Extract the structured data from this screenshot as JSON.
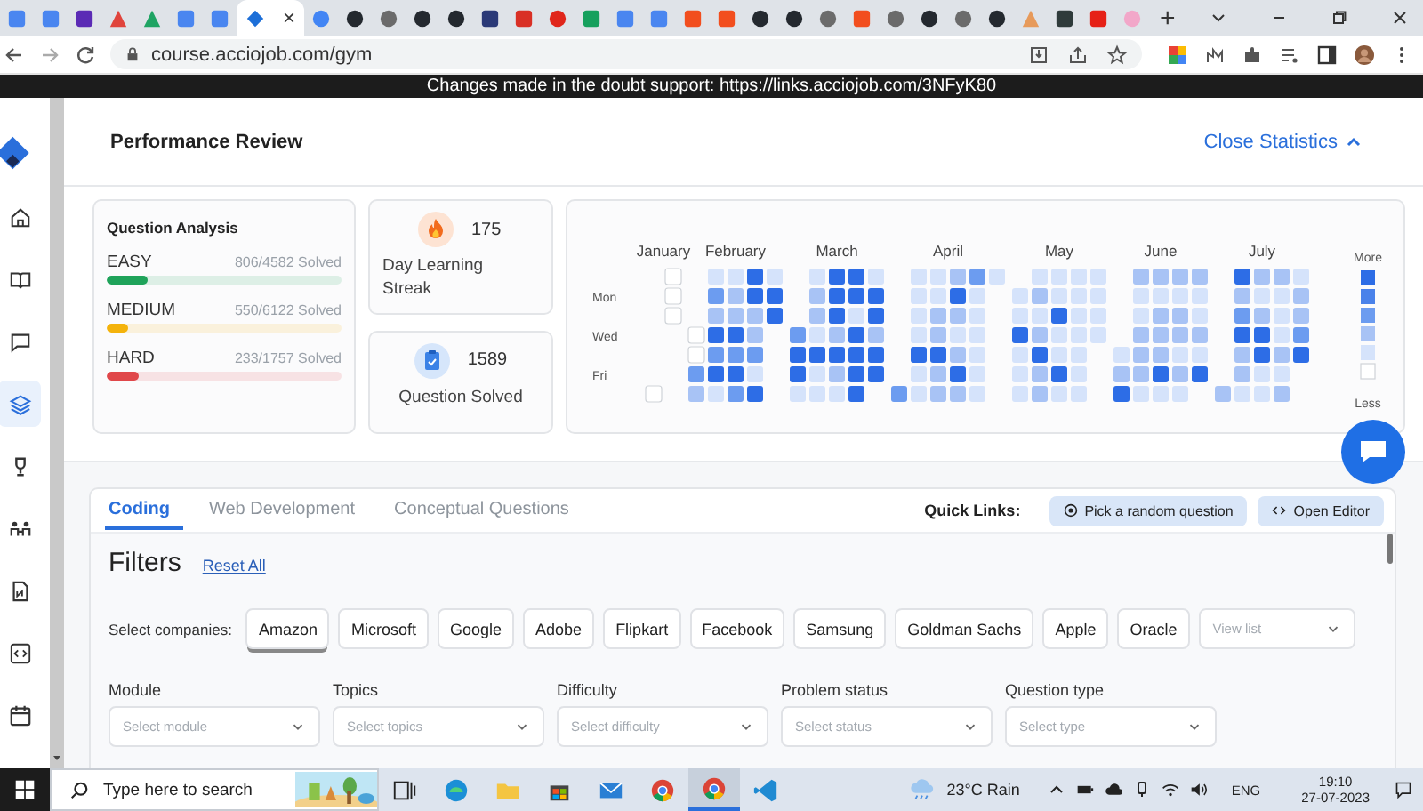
{
  "browser": {
    "tabs": [
      {
        "kind": "square",
        "color": "#4a86f0",
        "selected": false
      },
      {
        "kind": "square",
        "color": "#4a86f0",
        "selected": false
      },
      {
        "kind": "square",
        "color": "#5b2bb5",
        "selected": false
      },
      {
        "kind": "triangle",
        "color": "#e0443c",
        "selected": false
      },
      {
        "kind": "triangle",
        "color": "#1fa463",
        "selected": false
      },
      {
        "kind": "square",
        "color": "#4a86f0",
        "selected": false
      },
      {
        "kind": "square",
        "color": "#4a86f0",
        "selected": false
      },
      {
        "kind": "diamond",
        "color": "#1d6fd8",
        "selected": true
      },
      {
        "kind": "circle",
        "color": "#4285f4",
        "selected": false
      },
      {
        "kind": "circle",
        "color": "#24292f",
        "selected": false
      },
      {
        "kind": "circle",
        "color": "#6b6b6b",
        "selected": false
      },
      {
        "kind": "circle",
        "color": "#24292f",
        "selected": false
      },
      {
        "kind": "circle",
        "color": "#24292f",
        "selected": false
      },
      {
        "kind": "square",
        "color": "#2b3a78",
        "selected": false
      },
      {
        "kind": "square",
        "color": "#d93025",
        "selected": false
      },
      {
        "kind": "circle",
        "color": "#e0261b",
        "selected": false
      },
      {
        "kind": "square",
        "color": "#16a05d",
        "selected": false
      },
      {
        "kind": "square",
        "color": "#4a86f0",
        "selected": false
      },
      {
        "kind": "square",
        "color": "#4a86f0",
        "selected": false
      },
      {
        "kind": "square",
        "color": "#f24e1e",
        "selected": false
      },
      {
        "kind": "square",
        "color": "#f24e1e",
        "selected": false
      },
      {
        "kind": "circle",
        "color": "#24292f",
        "selected": false
      },
      {
        "kind": "circle",
        "color": "#24292f",
        "selected": false
      },
      {
        "kind": "circle",
        "color": "#6b6b6b",
        "selected": false
      },
      {
        "kind": "square",
        "color": "#f24e1e",
        "selected": false
      },
      {
        "kind": "circle",
        "color": "#6b6b6b",
        "selected": false
      },
      {
        "kind": "circle",
        "color": "#24292f",
        "selected": false
      },
      {
        "kind": "circle",
        "color": "#6b6b6b",
        "selected": false
      },
      {
        "kind": "circle",
        "color": "#24292f",
        "selected": false
      },
      {
        "kind": "triangle",
        "color": "#e79a5a",
        "selected": false
      },
      {
        "kind": "square",
        "color": "#2f3b3b",
        "selected": false
      },
      {
        "kind": "square",
        "color": "#e62117",
        "selected": false
      },
      {
        "kind": "circle",
        "color": "#f2a7c9",
        "selected": false
      }
    ],
    "close_glyph": "×",
    "new_tab": "+",
    "url": "course.acciojob.com/gym"
  },
  "banner": "Changes made in the doubt support: https://links.acciojob.com/3NFyK80",
  "sidebar": {
    "items": [
      {
        "kind": "home",
        "selected": false
      },
      {
        "kind": "book",
        "selected": false
      },
      {
        "kind": "chat",
        "selected": false
      },
      {
        "kind": "layers",
        "selected": true
      },
      {
        "kind": "trophy",
        "selected": false
      },
      {
        "kind": "people",
        "selected": false
      },
      {
        "kind": "file",
        "selected": false
      },
      {
        "kind": "code",
        "selected": false
      },
      {
        "kind": "calendar",
        "selected": false
      }
    ]
  },
  "header": {
    "title": "Performance Review",
    "toggle": "Close Statistics"
  },
  "question_analysis": {
    "title": "Question Analysis",
    "rows": [
      {
        "label": "EASY",
        "solved": "806/4582 Solved",
        "level": 0.176,
        "color": "#1fa35a"
      },
      {
        "label": "MEDIUM",
        "solved": "550/6122 Solved",
        "level": 0.09,
        "color": "#f4b30c"
      },
      {
        "label": "HARD",
        "solved": "233/1757 Solved",
        "level": 0.133,
        "color": "#e0474a"
      }
    ]
  },
  "streak": {
    "value": "175",
    "label": "Day Learning Streak"
  },
  "solved": {
    "value": "1589",
    "label": "Question Solved"
  },
  "heatmap": {
    "day_labels": [
      "Mon",
      "Wed",
      "Fri"
    ],
    "more": "More",
    "less": "Less",
    "months": [
      {
        "name": "January",
        "weeks": [
          [
            {
              "kind": "gap"
            },
            {
              "kind": "gap"
            },
            {
              "kind": "gap"
            },
            {
              "kind": "gap"
            },
            {
              "kind": "gap"
            },
            {
              "kind": "gap"
            },
            {
              "kind": "zero"
            }
          ],
          [
            {
              "kind": "zero"
            },
            {
              "kind": "zero"
            },
            {
              "kind": "zero"
            },
            {
              "kind": "gap"
            },
            {
              "kind": "gap"
            },
            {
              "kind": "gap"
            },
            {
              "kind": "gap"
            }
          ]
        ]
      },
      {
        "name": "February",
        "weeks": [
          [
            {
              "kind": "gap"
            },
            {
              "kind": "gap"
            },
            {
              "kind": "gap"
            },
            {
              "kind": "zero"
            },
            {
              "kind": "zero"
            },
            {
              "kind": "high"
            },
            {
              "kind": "medium"
            }
          ],
          [
            {
              "kind": "low"
            },
            {
              "kind": "high"
            },
            {
              "kind": "medium"
            },
            {
              "kind": "max"
            },
            {
              "kind": "high"
            },
            {
              "kind": "max"
            },
            {
              "kind": "low"
            }
          ],
          [
            {
              "kind": "low"
            },
            {
              "kind": "medium"
            },
            {
              "kind": "medium"
            },
            {
              "kind": "max"
            },
            {
              "kind": "high"
            },
            {
              "kind": "max"
            },
            {
              "kind": "high"
            }
          ],
          [
            {
              "kind": "max"
            },
            {
              "kind": "max"
            },
            {
              "kind": "medium"
            },
            {
              "kind": "medium"
            },
            {
              "kind": "high"
            },
            {
              "kind": "low"
            },
            {
              "kind": "max"
            }
          ],
          [
            {
              "kind": "low"
            },
            {
              "kind": "max"
            },
            {
              "kind": "max"
            },
            {
              "kind": "gap"
            },
            {
              "kind": "gap"
            },
            {
              "kind": "gap"
            },
            {
              "kind": "gap"
            }
          ]
        ]
      },
      {
        "name": "March",
        "weeks": [
          [
            {
              "kind": "gap"
            },
            {
              "kind": "gap"
            },
            {
              "kind": "gap"
            },
            {
              "kind": "high"
            },
            {
              "kind": "max"
            },
            {
              "kind": "max"
            },
            {
              "kind": "low"
            }
          ],
          [
            {
              "kind": "low"
            },
            {
              "kind": "medium"
            },
            {
              "kind": "medium"
            },
            {
              "kind": "low"
            },
            {
              "kind": "max"
            },
            {
              "kind": "low"
            },
            {
              "kind": "low"
            }
          ],
          [
            {
              "kind": "max"
            },
            {
              "kind": "max"
            },
            {
              "kind": "max"
            },
            {
              "kind": "medium"
            },
            {
              "kind": "max"
            },
            {
              "kind": "medium"
            },
            {
              "kind": "low"
            }
          ],
          [
            {
              "kind": "max"
            },
            {
              "kind": "max"
            },
            {
              "kind": "low"
            },
            {
              "kind": "max"
            },
            {
              "kind": "max"
            },
            {
              "kind": "max"
            },
            {
              "kind": "max"
            }
          ],
          [
            {
              "kind": "low"
            },
            {
              "kind": "max"
            },
            {
              "kind": "max"
            },
            {
              "kind": "medium"
            },
            {
              "kind": "max"
            },
            {
              "kind": "max"
            },
            {
              "kind": "gap"
            }
          ]
        ]
      },
      {
        "name": "April",
        "weeks": [
          [
            {
              "kind": "gap"
            },
            {
              "kind": "gap"
            },
            {
              "kind": "gap"
            },
            {
              "kind": "gap"
            },
            {
              "kind": "gap"
            },
            {
              "kind": "gap"
            },
            {
              "kind": "high"
            }
          ],
          [
            {
              "kind": "low"
            },
            {
              "kind": "low"
            },
            {
              "kind": "low"
            },
            {
              "kind": "low"
            },
            {
              "kind": "max"
            },
            {
              "kind": "low"
            },
            {
              "kind": "low"
            }
          ],
          [
            {
              "kind": "low"
            },
            {
              "kind": "low"
            },
            {
              "kind": "medium"
            },
            {
              "kind": "medium"
            },
            {
              "kind": "max"
            },
            {
              "kind": "medium"
            },
            {
              "kind": "medium"
            }
          ],
          [
            {
              "kind": "medium"
            },
            {
              "kind": "max"
            },
            {
              "kind": "medium"
            },
            {
              "kind": "low"
            },
            {
              "kind": "medium"
            },
            {
              "kind": "max"
            },
            {
              "kind": "medium"
            }
          ],
          [
            {
              "kind": "high"
            },
            {
              "kind": "low"
            },
            {
              "kind": "low"
            },
            {
              "kind": "low"
            },
            {
              "kind": "low"
            },
            {
              "kind": "low"
            },
            {
              "kind": "low"
            }
          ],
          [
            {
              "kind": "low"
            },
            {
              "kind": "gap"
            },
            {
              "kind": "gap"
            },
            {
              "kind": "gap"
            },
            {
              "kind": "gap"
            },
            {
              "kind": "gap"
            },
            {
              "kind": "gap"
            }
          ]
        ]
      },
      {
        "name": "May",
        "weeks": [
          [
            {
              "kind": "gap"
            },
            {
              "kind": "low"
            },
            {
              "kind": "low"
            },
            {
              "kind": "max"
            },
            {
              "kind": "low"
            },
            {
              "kind": "low"
            },
            {
              "kind": "low"
            }
          ],
          [
            {
              "kind": "low"
            },
            {
              "kind": "medium"
            },
            {
              "kind": "low"
            },
            {
              "kind": "medium"
            },
            {
              "kind": "max"
            },
            {
              "kind": "medium"
            },
            {
              "kind": "medium"
            }
          ],
          [
            {
              "kind": "low"
            },
            {
              "kind": "low"
            },
            {
              "kind": "max"
            },
            {
              "kind": "low"
            },
            {
              "kind": "low"
            },
            {
              "kind": "max"
            },
            {
              "kind": "low"
            }
          ],
          [
            {
              "kind": "low"
            },
            {
              "kind": "low"
            },
            {
              "kind": "low"
            },
            {
              "kind": "low"
            },
            {
              "kind": "low"
            },
            {
              "kind": "low"
            },
            {
              "kind": "low"
            }
          ],
          [
            {
              "kind": "low"
            },
            {
              "kind": "low"
            },
            {
              "kind": "low"
            },
            {
              "kind": "low"
            },
            {
              "kind": "gap"
            },
            {
              "kind": "gap"
            },
            {
              "kind": "gap"
            }
          ]
        ]
      },
      {
        "name": "June",
        "weeks": [
          [
            {
              "kind": "gap"
            },
            {
              "kind": "gap"
            },
            {
              "kind": "gap"
            },
            {
              "kind": "gap"
            },
            {
              "kind": "low"
            },
            {
              "kind": "medium"
            },
            {
              "kind": "max"
            }
          ],
          [
            {
              "kind": "medium"
            },
            {
              "kind": "low"
            },
            {
              "kind": "low"
            },
            {
              "kind": "medium"
            },
            {
              "kind": "medium"
            },
            {
              "kind": "medium"
            },
            {
              "kind": "low"
            }
          ],
          [
            {
              "kind": "medium"
            },
            {
              "kind": "low"
            },
            {
              "kind": "medium"
            },
            {
              "kind": "medium"
            },
            {
              "kind": "medium"
            },
            {
              "kind": "max"
            },
            {
              "kind": "low"
            }
          ],
          [
            {
              "kind": "medium"
            },
            {
              "kind": "low"
            },
            {
              "kind": "medium"
            },
            {
              "kind": "medium"
            },
            {
              "kind": "low"
            },
            {
              "kind": "medium"
            },
            {
              "kind": "low"
            }
          ],
          [
            {
              "kind": "medium"
            },
            {
              "kind": "low"
            },
            {
              "kind": "low"
            },
            {
              "kind": "medium"
            },
            {
              "kind": "low"
            },
            {
              "kind": "max"
            },
            {
              "kind": "gap"
            }
          ]
        ]
      },
      {
        "name": "July",
        "weeks": [
          [
            {
              "kind": "gap"
            },
            {
              "kind": "gap"
            },
            {
              "kind": "gap"
            },
            {
              "kind": "gap"
            },
            {
              "kind": "gap"
            },
            {
              "kind": "gap"
            },
            {
              "kind": "medium"
            }
          ],
          [
            {
              "kind": "max"
            },
            {
              "kind": "medium"
            },
            {
              "kind": "high"
            },
            {
              "kind": "max"
            },
            {
              "kind": "medium"
            },
            {
              "kind": "medium"
            },
            {
              "kind": "low"
            }
          ],
          [
            {
              "kind": "medium"
            },
            {
              "kind": "low"
            },
            {
              "kind": "medium"
            },
            {
              "kind": "max"
            },
            {
              "kind": "max"
            },
            {
              "kind": "low"
            },
            {
              "kind": "low"
            }
          ],
          [
            {
              "kind": "medium"
            },
            {
              "kind": "low"
            },
            {
              "kind": "low"
            },
            {
              "kind": "low"
            },
            {
              "kind": "medium"
            },
            {
              "kind": "low"
            },
            {
              "kind": "medium"
            }
          ],
          [
            {
              "kind": "low"
            },
            {
              "kind": "medium"
            },
            {
              "kind": "medium"
            },
            {
              "kind": "high"
            },
            {
              "kind": "max"
            },
            {
              "kind": "gap"
            },
            {
              "kind": "gap"
            }
          ]
        ]
      }
    ]
  },
  "tabs": [
    {
      "label": "Coding",
      "selected": true
    },
    {
      "label": "Web Development",
      "selected": false
    },
    {
      "label": "Conceptual Questions",
      "selected": false
    }
  ],
  "quick_links": {
    "label": "Quick Links:",
    "buttons": [
      {
        "kind": "random",
        "label": "Pick a random question"
      },
      {
        "kind": "editor",
        "label": "Open Editor"
      }
    ]
  },
  "filters": {
    "title": "Filters",
    "reset": "Reset All",
    "companies_label": "Select companies:",
    "companies": [
      {
        "label": "Amazon",
        "selected": true
      },
      {
        "label": "Microsoft",
        "selected": false
      },
      {
        "label": "Google",
        "selected": false
      },
      {
        "label": "Adobe",
        "selected": false
      },
      {
        "label": "Flipkart",
        "selected": false
      },
      {
        "label": "Facebook",
        "selected": false
      },
      {
        "label": "Samsung",
        "selected": false
      },
      {
        "label": "Goldman Sachs",
        "selected": false
      },
      {
        "label": "Apple",
        "selected": false
      },
      {
        "label": "Oracle",
        "selected": false
      }
    ],
    "view_list": "View list",
    "dropdowns": [
      {
        "label": "Module",
        "placeholder": "Select module"
      },
      {
        "label": "Topics",
        "placeholder": "Select topics"
      },
      {
        "label": "Difficulty",
        "placeholder": "Select difficulty"
      },
      {
        "label": "Problem status",
        "placeholder": "Select status"
      },
      {
        "label": "Question type",
        "placeholder": "Select type"
      }
    ]
  },
  "taskbar": {
    "search_placeholder": "Type here to search",
    "apps": [
      {
        "kind": "taskview",
        "selected": false
      },
      {
        "kind": "edge",
        "selected": false
      },
      {
        "kind": "folder",
        "selected": false
      },
      {
        "kind": "store",
        "selected": false
      },
      {
        "kind": "mail",
        "selected": false
      },
      {
        "kind": "chrome",
        "selected": false
      },
      {
        "kind": "chrome",
        "selected": true
      },
      {
        "kind": "vscode",
        "selected": false
      }
    ],
    "weather": "23°C Rain",
    "language": "ENG",
    "time": "19:10",
    "date": "27-07-2023"
  }
}
